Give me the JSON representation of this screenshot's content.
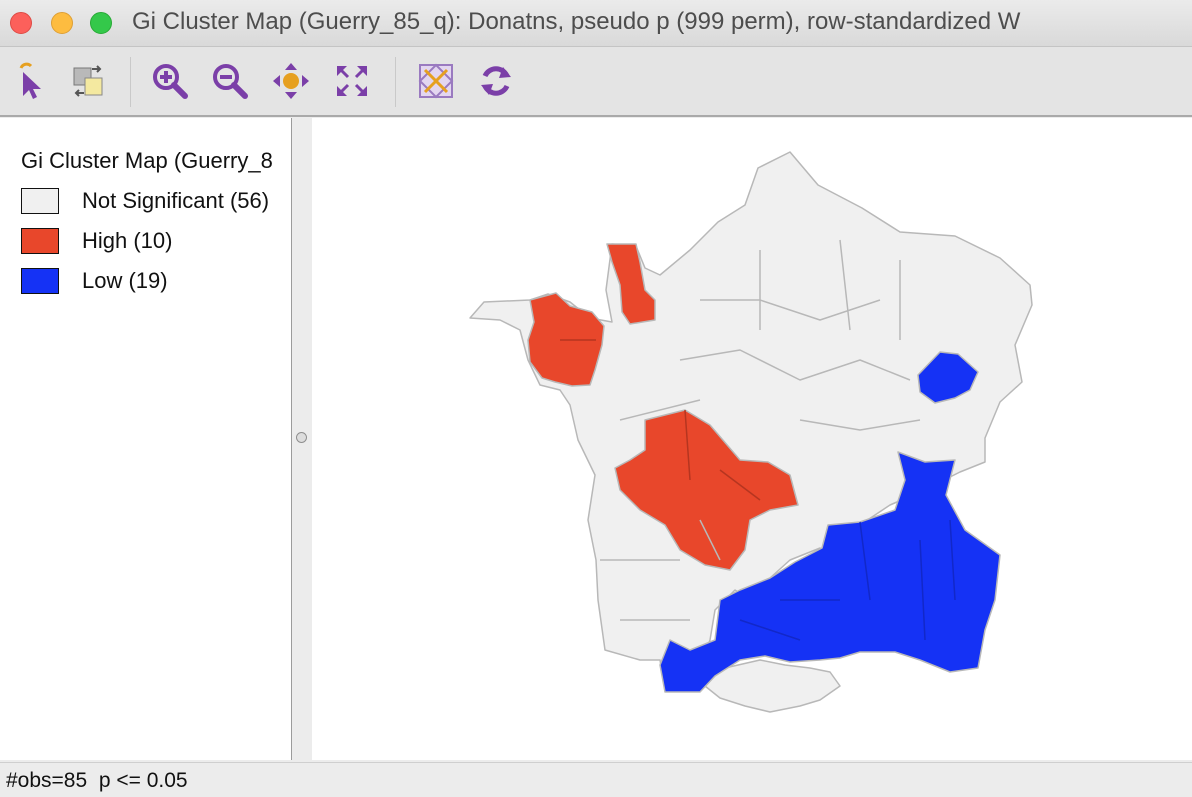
{
  "window": {
    "title": "Gi Cluster Map (Guerry_85_q): Donatns, pseudo p (999 perm), row-standardized W"
  },
  "toolbar": {
    "buttons": [
      "select-tool",
      "selection-options",
      "zoom-in",
      "zoom-out",
      "pan",
      "fit-to-window",
      "map-toggle",
      "refresh"
    ],
    "icon_color": "#7b3fa8"
  },
  "legend": {
    "title": "Gi Cluster Map (Guerry_8",
    "items": [
      {
        "label": "Not Significant (56)",
        "color": "#f0f0f0"
      },
      {
        "label": "High (10)",
        "color": "#e8472b"
      },
      {
        "label": "Low (19)",
        "color": "#1532f5"
      }
    ]
  },
  "status": {
    "text": "#obs=85  p <= 0.05"
  }
}
